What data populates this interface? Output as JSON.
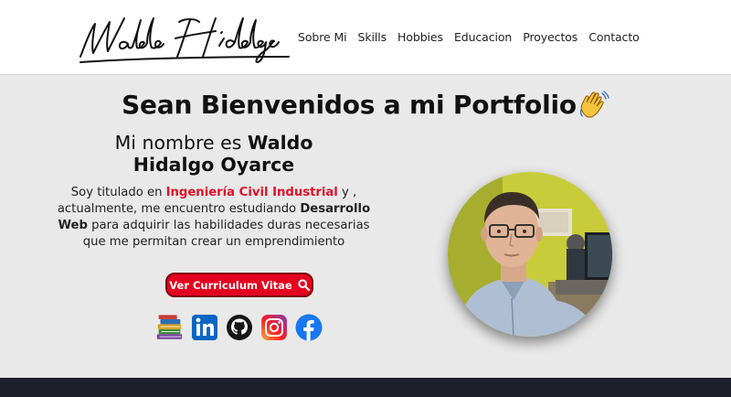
{
  "header": {
    "logo_text": "Waldo Hidalgo",
    "nav": [
      {
        "label": "Sobre Mi"
      },
      {
        "label": "Skills"
      },
      {
        "label": "Hobbies"
      },
      {
        "label": "Educacion"
      },
      {
        "label": "Proyectos"
      },
      {
        "label": "Contacto"
      }
    ]
  },
  "hero": {
    "title": "Sean Bienvenidos a mi Portfolio",
    "name_prefix": "Mi nombre es ",
    "name_first": "Waldo",
    "name_rest": "Hidalgo Oyarce",
    "desc_part1": "Soy titulado en ",
    "desc_highlight": "Ingeniería Civil Industrial",
    "desc_part2": " y , actualmente, me encuentro estudiando ",
    "desc_bold": "Desarrollo Web",
    "desc_part3": " para adquirir las habilidades duras necesarias que me permitan crear un emprendimiento",
    "cv_button": "Ver Curriculum Vitae"
  },
  "socials": [
    {
      "icon": "books-icon"
    },
    {
      "icon": "linkedin-icon"
    },
    {
      "icon": "github-icon"
    },
    {
      "icon": "instagram-icon"
    },
    {
      "icon": "facebook-icon"
    }
  ],
  "colors": {
    "accent_red": "#e4001f",
    "highlight_red": "#e0102a",
    "footer": "#1d1f2b",
    "background": "#e9e9e9"
  }
}
